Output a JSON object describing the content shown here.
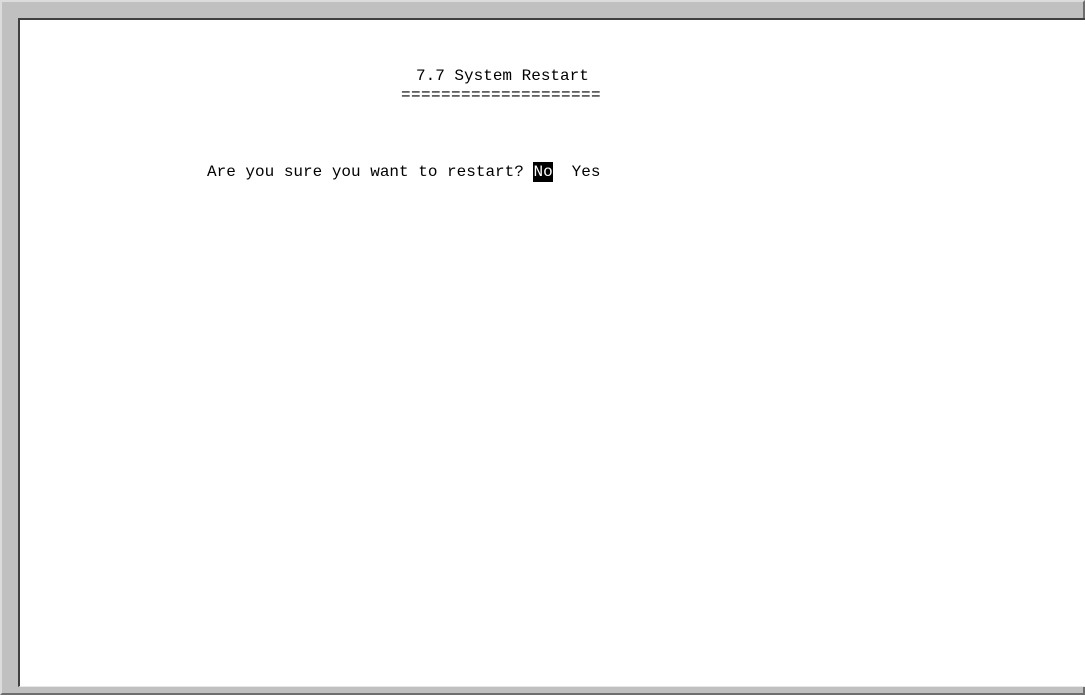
{
  "screen": {
    "title": "7.7 System Restart",
    "title_underline": "===================="
  },
  "dialog": {
    "question": "Are you sure you want to restart?",
    "options": [
      {
        "label": "No",
        "selected": true
      },
      {
        "label": "Yes",
        "selected": false
      }
    ]
  },
  "colors": {
    "frame": "#c0c0c0",
    "background": "#ffffff",
    "text": "#000000",
    "highlight_bg": "#000000",
    "highlight_fg": "#ffffff"
  }
}
